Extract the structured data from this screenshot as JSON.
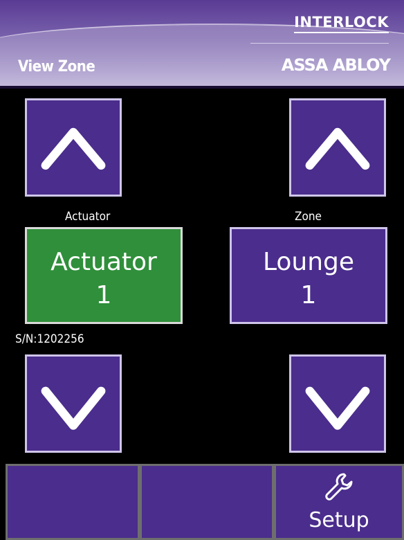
{
  "header": {
    "title": "View Zone",
    "brand_top": "INTERLOCK",
    "brand_bottom": "ASSA ABLOY"
  },
  "actuator": {
    "label": "Actuator",
    "value_line1": "Actuator",
    "value_line2": "1",
    "serial": "S/N:1202256",
    "color": "#2f8f3a"
  },
  "zone": {
    "label": "Zone",
    "value_line1": "Lounge",
    "value_line2": "1",
    "color": "#4a2d8c"
  },
  "bottom_bar": {
    "tabs": [
      {
        "label": "",
        "icon": ""
      },
      {
        "label": "",
        "icon": ""
      },
      {
        "label": "Setup",
        "icon": "wrench-icon"
      }
    ]
  },
  "icons": {
    "up": "chevron-up-icon",
    "down": "chevron-down-icon"
  }
}
